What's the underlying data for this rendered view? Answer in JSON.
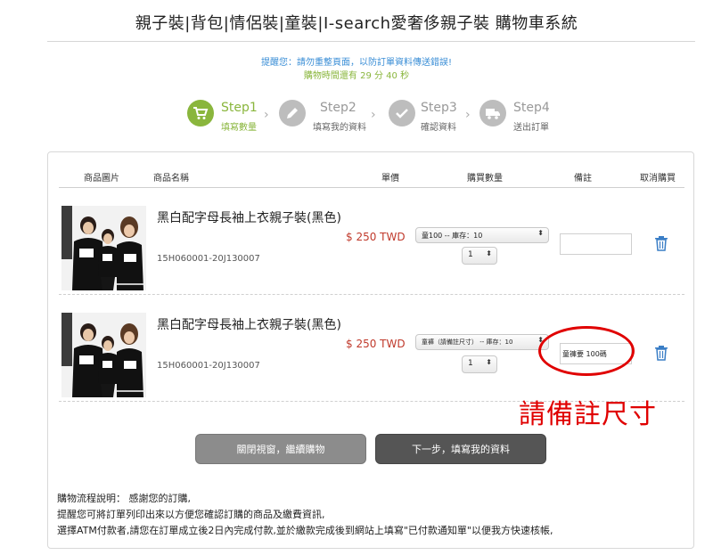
{
  "header": {
    "title": "親子裝|背包|情侶裝|童裝|I-search愛奢侈親子裝 購物車系統",
    "notice": "提醒您：請勿重整頁面，以防訂單資料傳送錯誤!",
    "timer": "購物時間還有 29 分 40 秒"
  },
  "steps": [
    {
      "label": "Step1",
      "sub": "填寫數量",
      "icon": "cart-icon",
      "active": true
    },
    {
      "label": "Step2",
      "sub": "填寫我的資料",
      "icon": "pencil-icon",
      "active": false
    },
    {
      "label": "Step3",
      "sub": "確認資料",
      "icon": "check-icon",
      "active": false
    },
    {
      "label": "Step4",
      "sub": "送出訂單",
      "icon": "truck-icon",
      "active": false
    }
  ],
  "table": {
    "headers": [
      "商品圖片",
      "商品名稱",
      "單價",
      "購買數量",
      "備註",
      "取消購買"
    ],
    "rows": [
      {
        "name": "黑白配字母長袖上衣親子裝(黑色)",
        "code": "15H060001-20J130007",
        "price": "$ 250 TWD",
        "size_option": "童100 -- 庫存：10",
        "qty": "1",
        "note": ""
      },
      {
        "name": "黑白配字母長袖上衣親子裝(黑色)",
        "code": "15H060001-20J130007",
        "price": "$ 250 TWD",
        "size_option": "童褲（請備註尺寸） -- 庫存：10",
        "qty": "1",
        "note": "童褲要 100碼"
      }
    ]
  },
  "buttons": {
    "close": "關閉視窗，繼續購物",
    "next": "下一步，填寫我的資料"
  },
  "description": [
    "購物流程說明： 感謝您的訂購,",
    "提醒您可將訂單列印出來以方便您確認訂購的商品及繳費資訊,",
    "選擇ATM付款者,請您在訂單成立後2日內完成付款,並於繳款完成後到網站上填寫\"已付款通知單\"以便我方快速核帳,"
  ],
  "annotation": {
    "text": "請備註尺寸"
  },
  "colors": {
    "accent_green": "#8ab63d",
    "notice_blue": "#3a8ed6",
    "price_red": "#c0392b",
    "annotation_red": "#e00000",
    "trash_blue": "#3a7ec6"
  }
}
